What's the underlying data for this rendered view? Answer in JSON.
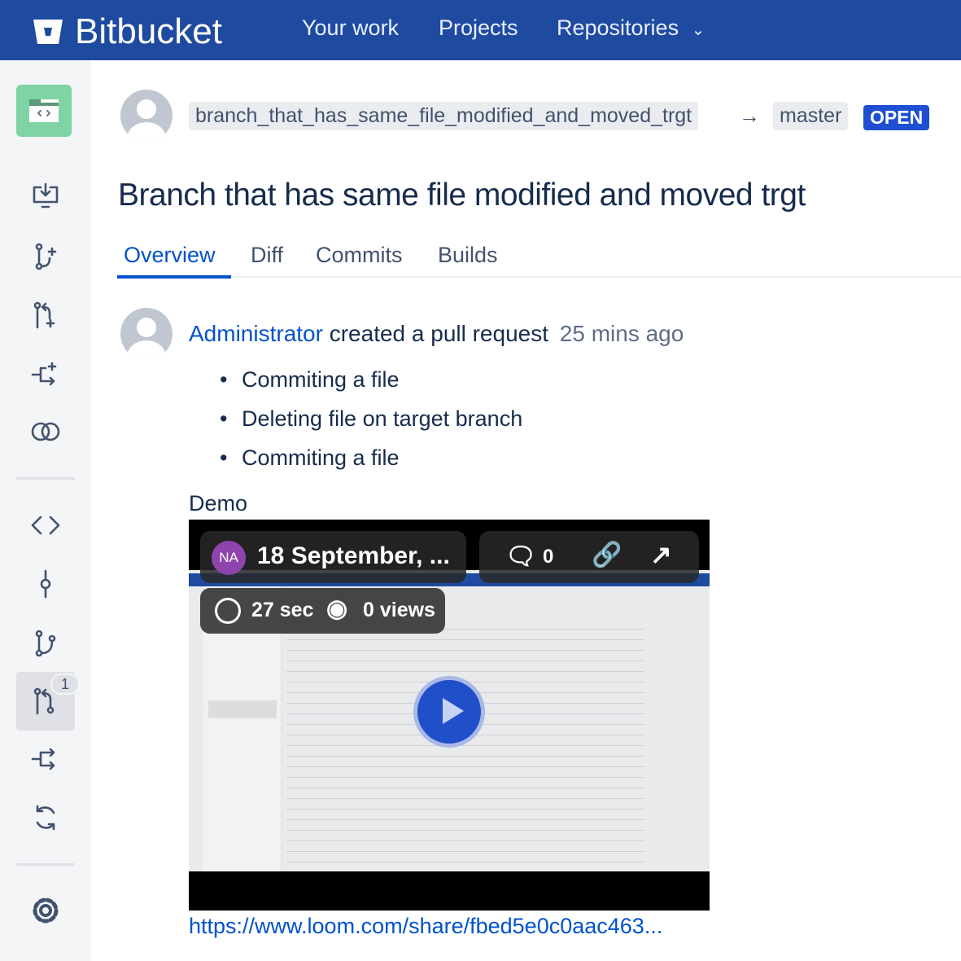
{
  "header": {
    "logo_text": "Bitbucket",
    "nav": [
      {
        "label": "Your work"
      },
      {
        "label": "Projects"
      },
      {
        "label": "Repositories"
      }
    ],
    "brand_color": "#1e4aa0"
  },
  "sidebar": {
    "items": [
      {
        "icon": "repository-icon"
      },
      {
        "icon": "clone-icon"
      },
      {
        "icon": "create-branch-icon"
      },
      {
        "icon": "create-pull-request-icon"
      },
      {
        "icon": "create-fork-icon"
      },
      {
        "icon": "compare-icon"
      },
      {
        "icon": "source-icon"
      },
      {
        "icon": "commits-icon"
      },
      {
        "icon": "branches-icon"
      },
      {
        "icon": "pull-requests-icon",
        "badge": "1",
        "selected": true
      },
      {
        "icon": "forks-icon"
      },
      {
        "icon": "sync-icon"
      },
      {
        "icon": "settings-icon"
      }
    ]
  },
  "pr": {
    "source_branch": "branch_that_has_same_file_modified_and_moved_trgt",
    "target_branch": "master",
    "status": "OPEN",
    "status_color": "#1d4fd0",
    "title": "Branch that has same file modified and moved trgt",
    "tabs": [
      {
        "label": "Overview",
        "active": true
      },
      {
        "label": "Diff"
      },
      {
        "label": "Commits"
      },
      {
        "label": "Builds"
      }
    ]
  },
  "activity": {
    "author": "Administrator",
    "action": "created a pull request",
    "time": "25 mins ago",
    "commits": [
      "Commiting a file",
      "Deleting file on target branch",
      "Commiting a file"
    ],
    "demo_label": "Demo",
    "video": {
      "avatar_initials": "NA",
      "title": "18 September, ...",
      "comments": "0",
      "duration": "27 sec",
      "views": "0 views"
    },
    "link": "https://www.loom.com/share/fbed5e0c0aac463..."
  }
}
